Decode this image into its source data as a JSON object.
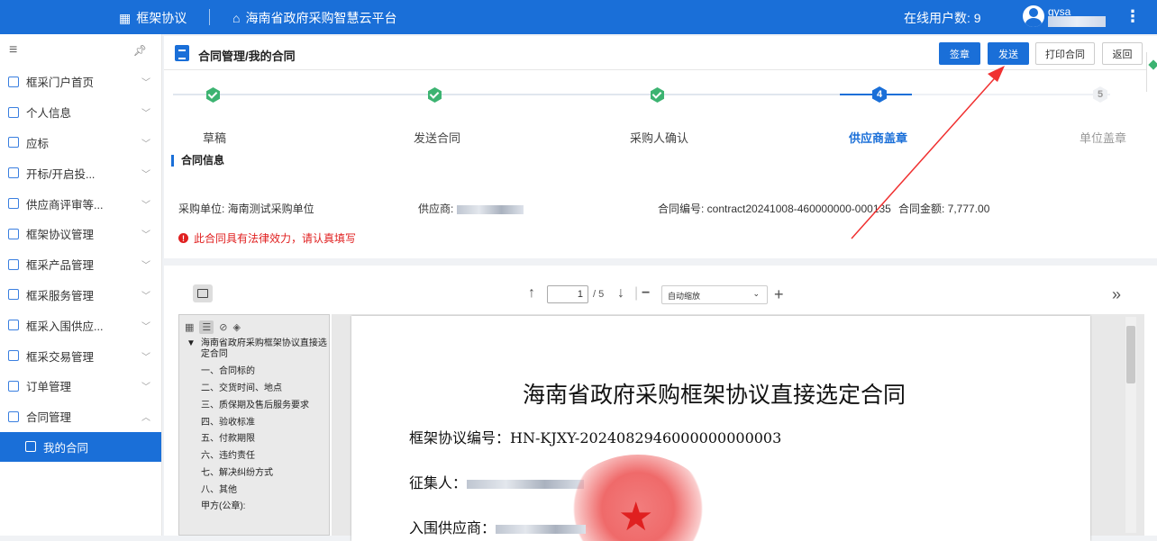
{
  "topbar": {
    "module": "框架协议",
    "platform": "海南省政府采购智慧云平台",
    "online_label": "在线用户数:",
    "online_count": "9",
    "username": "gysa"
  },
  "sidebar": {
    "items": [
      {
        "label": "框采门户首页"
      },
      {
        "label": "个人信息"
      },
      {
        "label": "应标"
      },
      {
        "label": "开标/开启投..."
      },
      {
        "label": "供应商评审等..."
      },
      {
        "label": "框架协议管理"
      },
      {
        "label": "框采产品管理"
      },
      {
        "label": "框采服务管理"
      },
      {
        "label": "框采入围供应..."
      },
      {
        "label": "框采交易管理"
      },
      {
        "label": "订单管理"
      },
      {
        "label": "合同管理"
      }
    ],
    "active": "我的合同"
  },
  "title": "合同管理/我的合同",
  "buttons": {
    "sign": "签章",
    "send": "发送",
    "print": "打印合同",
    "back": "返回"
  },
  "steps": [
    {
      "label": "草稿",
      "status": "done"
    },
    {
      "label": "发送合同",
      "status": "done"
    },
    {
      "label": "采购人确认",
      "status": "done"
    },
    {
      "label": "供应商盖章",
      "status": "current",
      "num": "4"
    },
    {
      "label": "单位盖章",
      "status": "pending",
      "num": "5"
    }
  ],
  "section_title": "合同信息",
  "info": {
    "buyer": "采购单位: 海南测试采购单位",
    "supplier_label": "供应商:",
    "contract_no": "合同编号: contract20241008-460000000-000135",
    "amount": "合同金额: 7,777.00",
    "warning": "此合同具有法律效力，请认真填写"
  },
  "pdf": {
    "page": "1",
    "total": "/ 5",
    "zoom": "自动缩放",
    "outline": [
      "一、合同标的",
      "二、交货时间、地点",
      "三、质保期及售后服务要求",
      "四、验收标准",
      "五、付款期限",
      "六、违约责任",
      "七、解决纠纷方式",
      "八、其他",
      "甲方(公章):"
    ],
    "outline_root": "海南省政府采购框架协议直接选定合同",
    "doc_title": "海南省政府采购框架协议直接选定合同",
    "doc_no": "框架协议编号：HN-KJXY-2024082946000000000003",
    "collector": "征集人：",
    "supplier": "入围供应商："
  },
  "colors": {
    "primary": "#1a6fd8",
    "success": "#3cb371",
    "danger": "#e02020"
  }
}
